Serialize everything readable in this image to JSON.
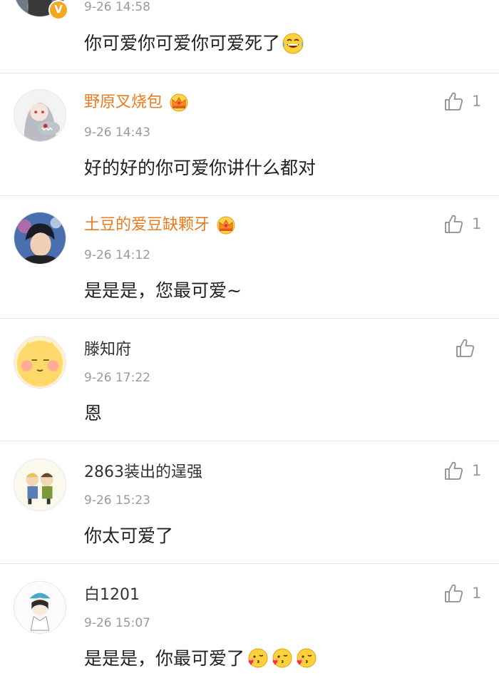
{
  "comments": [
    {
      "time": "9-26 14:58",
      "text": "你可爱你可爱你可爱死了"
    },
    {
      "user": "野原叉烧包",
      "time": "9-26 14:43",
      "text": "好的好的你可爱你讲什么都对",
      "likes": "1"
    },
    {
      "user": "土豆的爱豆缺颗牙",
      "time": "9-26 14:12",
      "text": "是是是，您最可爱~",
      "likes": "1"
    },
    {
      "user": "滕知府",
      "time": "9-26 17:22",
      "text": "恩"
    },
    {
      "user": "2863装出的逞强",
      "time": "9-26 15:23",
      "text": "你太可爱了",
      "likes": "1"
    },
    {
      "user": "白1201",
      "time": "9-26 15:07",
      "text": "是是是，你最可爱了",
      "likes": "1"
    }
  ],
  "badges": {
    "verified": "V"
  },
  "icons": [
    "thumbs-up-icon",
    "crown-icon",
    "laughing-emoji-icon",
    "blowing-kiss-emoji-icon"
  ],
  "colors": {
    "vip_name": "#e97b1e",
    "meta": "#9a9a9a",
    "divider": "#e8e8e8"
  }
}
